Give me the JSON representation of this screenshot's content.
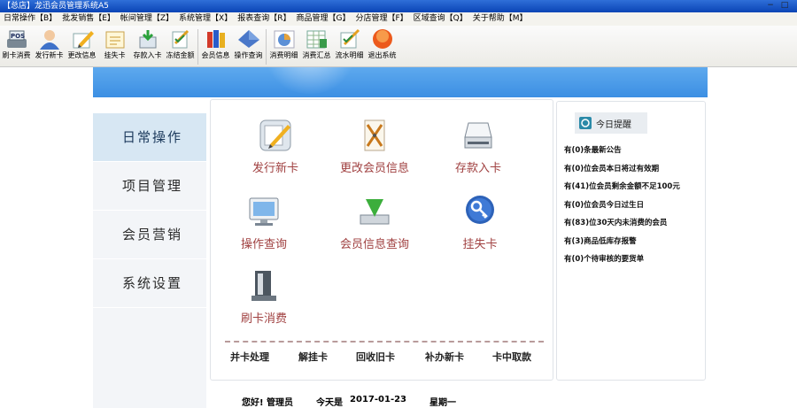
{
  "window": {
    "title": "【总店】龙迅会员管理系统A5",
    "controls": [
      "−",
      "□"
    ]
  },
  "menu": [
    "日常操作【B】",
    "批发销售【E】",
    "帐间管理【Z】",
    "系统管理【X】",
    "报表查询【R】",
    "商品管理【G】",
    "分店管理【F】",
    "区域查询【Q】",
    "关于帮助【M】"
  ],
  "toolbar": [
    {
      "label": "刷卡消费",
      "icon": "pos-icon"
    },
    {
      "label": "发行新卡",
      "icon": "user-card-icon"
    },
    {
      "label": "更改信息",
      "icon": "edit-note-icon"
    },
    {
      "label": "挂失卡",
      "icon": "lost-card-icon"
    },
    {
      "label": "存款入卡",
      "icon": "deposit-icon"
    },
    {
      "label": "冻结金额",
      "icon": "freeze-icon"
    },
    {
      "label": "会员信息",
      "icon": "books-icon"
    },
    {
      "label": "操作查询",
      "icon": "query-icon"
    },
    {
      "label": "消费明细",
      "icon": "pie-chart-icon"
    },
    {
      "label": "消费汇总",
      "icon": "spreadsheet-icon"
    },
    {
      "label": "流水明细",
      "icon": "flow-icon"
    },
    {
      "label": "退出系统",
      "icon": "exit-icon"
    }
  ],
  "nav": [
    "日常操作",
    "项目管理",
    "会员营销",
    "系统设置"
  ],
  "functions": [
    {
      "label": "发行新卡",
      "icon": "issue-card-icon"
    },
    {
      "label": "更改会员信息",
      "icon": "edit-member-icon"
    },
    {
      "label": "存款入卡",
      "icon": "scanner-icon"
    },
    {
      "label": "操作查询",
      "icon": "monitor-icon"
    },
    {
      "label": "会员信息查询",
      "icon": "download-icon"
    },
    {
      "label": "挂失卡",
      "icon": "key-icon"
    },
    {
      "label": "刷卡消费",
      "icon": "card-reader-icon"
    }
  ],
  "quick_links": [
    "并卡处理",
    "解挂卡",
    "回收旧卡",
    "补办新卡",
    "卡中取款"
  ],
  "reminders": {
    "title": "今日提醒",
    "items": [
      "有(0)条最新公告",
      "有(0)位会员本日将过有效期",
      "有(41)位会员剩余金额不足100元",
      "有(0)位会员今日过生日",
      "有(83)位30天内未消费的会员",
      "有(3)商品低库存报警",
      "有(0)个待审核的要货单"
    ]
  },
  "footer": {
    "greeting": "您好! 管理员",
    "today_label": "今天是",
    "date": "2017-01-23",
    "weekday": "星期一"
  }
}
